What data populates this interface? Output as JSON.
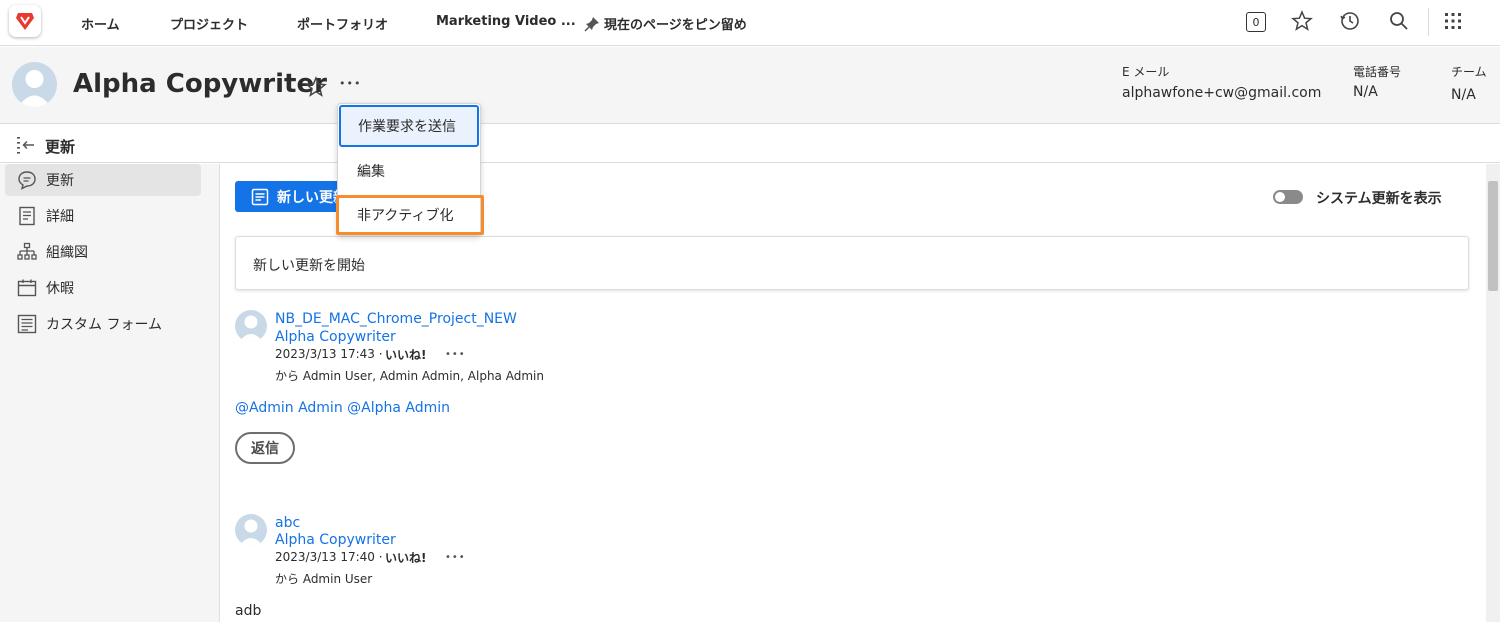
{
  "nav": {
    "home": "ホーム",
    "projects": "プロジェクト",
    "portfolios": "ポートフォリオ",
    "recent": "Marketing Video ...",
    "pin": "現在のページをピン留め",
    "notification_count": "0"
  },
  "header": {
    "title": "Alpha Copywriter",
    "more": "•••",
    "email_label": "E メール",
    "email_value": "alphawfone+cw@gmail.com",
    "phone_label": "電話番号",
    "phone_value": "N/A",
    "team_label": "チーム",
    "team_value": "N/A"
  },
  "subheader": {
    "title": "更新"
  },
  "sidebar": {
    "items": [
      {
        "label": "更新",
        "icon": "chat-bubble-icon"
      },
      {
        "label": "詳細",
        "icon": "document-icon"
      },
      {
        "label": "組織図",
        "icon": "org-chart-icon"
      },
      {
        "label": "休暇",
        "icon": "calendar-icon"
      },
      {
        "label": "カスタム フォーム",
        "icon": "form-icon"
      }
    ]
  },
  "main": {
    "new_update_button": "新しい更新",
    "system_updates_label": "システム更新を表示",
    "composer_placeholder": "新しい更新を開始",
    "posts": [
      {
        "title": "NB_DE_MAC_Chrome_Project_NEW",
        "author": "Alpha Copywriter",
        "timestamp": "2023/3/13 17:43 ·",
        "like": "いいね!",
        "more": "•••",
        "recipients": "から Admin User, Admin Admin, Alpha Admin",
        "body": "@Admin Admin @Alpha Admin",
        "reply": "返信"
      },
      {
        "title": "abc",
        "author": "Alpha Copywriter",
        "timestamp": "2023/3/13 17:40 ·",
        "like": "いいね!",
        "more": "•••",
        "recipients": "から Admin User",
        "body": "adb"
      }
    ]
  },
  "dropdown": {
    "items": [
      "作業要求を送信",
      "編集",
      "非アクティブ化"
    ]
  },
  "colors": {
    "accent": "#1473e6",
    "highlight": "#f68c2b",
    "brand": "#e8382f"
  }
}
